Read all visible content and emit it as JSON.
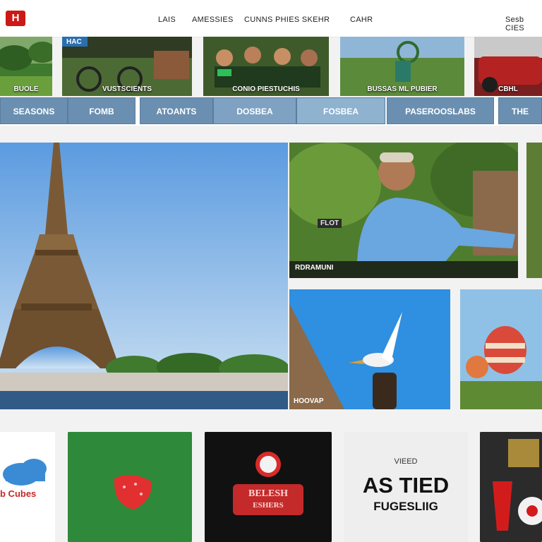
{
  "header": {
    "logo_text": "H",
    "nav": [
      "LAIS",
      "AMESSIES",
      "CUNNS PHIES SKEHR",
      "CAHR",
      "Sesb CIES"
    ]
  },
  "strip": {
    "labels": [
      "BUOLE",
      "VUSTSCIENTS",
      "CONIO PIESTUCHIS",
      "BUSSAS ML PUBIER",
      "CBHL"
    ],
    "badge": "HAC"
  },
  "categories": [
    "SEASONS",
    "FOMB",
    "ATOANTS",
    "DOSBEA",
    "FOSBEA",
    "PASEROOSLABS",
    "THE"
  ],
  "featured": {
    "person_caption": "RDRAMUNI",
    "person_badge": "FLOT",
    "bird_caption": "HOOVAP"
  },
  "tiles": {
    "cubes_label": "b Cubes",
    "center_label": "BELESH",
    "center_sub": "ESHERS",
    "small_caption": "VIEED",
    "big_line1": "AS TIED",
    "big_line2": "FUGESLIIG"
  },
  "colors": {
    "accent": "#cc1818",
    "category": "#6b8fb0"
  }
}
